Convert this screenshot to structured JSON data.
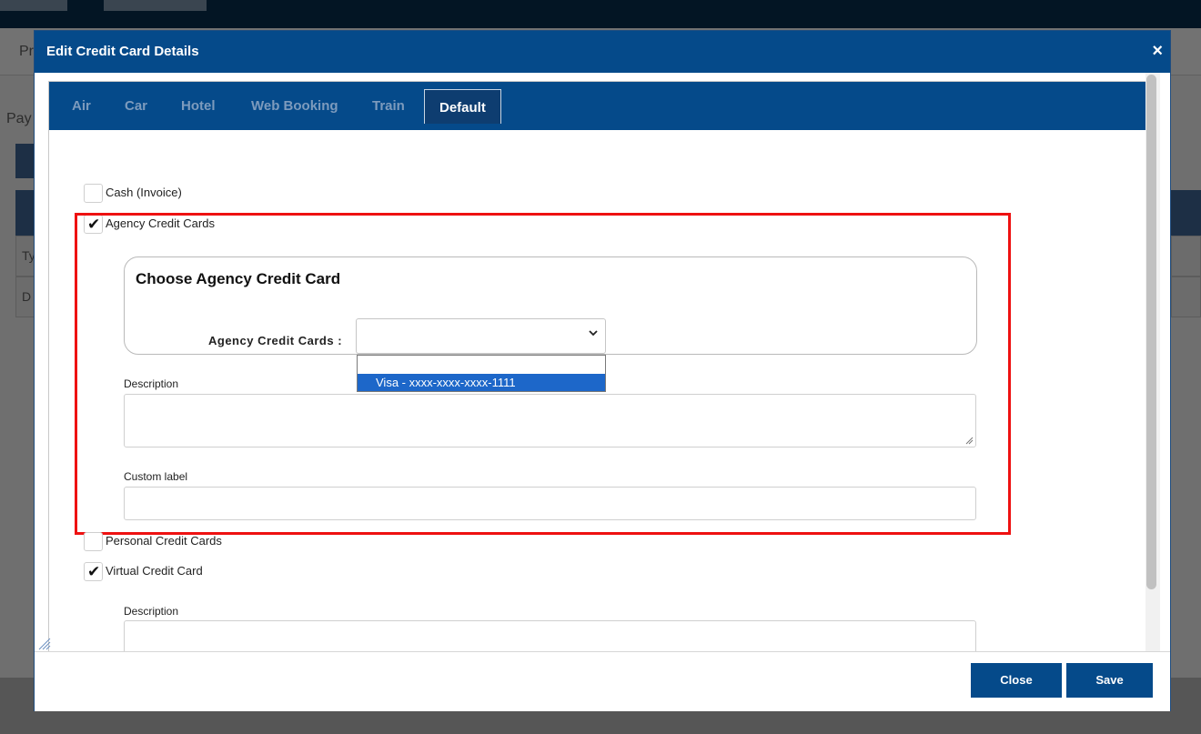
{
  "background": {
    "nav_text": "Pr",
    "section_text": "Pay",
    "row1_text": "Ty",
    "row2_text": "D"
  },
  "modal": {
    "title": "Edit Credit Card Details",
    "close_icon": "×"
  },
  "tabs": [
    {
      "label": "Air",
      "active": false
    },
    {
      "label": "Car",
      "active": false
    },
    {
      "label": "Hotel",
      "active": false
    },
    {
      "label": "Web Booking",
      "active": false
    },
    {
      "label": "Train",
      "active": false
    },
    {
      "label": "Default",
      "active": true
    }
  ],
  "options": {
    "cash": {
      "label": "Cash (Invoice)",
      "checked": false
    },
    "agency": {
      "label": "Agency Credit Cards",
      "checked": true
    },
    "personal": {
      "label": "Personal Credit Cards",
      "checked": false
    },
    "virtual": {
      "label": "Virtual Credit Card",
      "checked": true
    }
  },
  "agency_panel": {
    "title": "Choose Agency Credit Card",
    "select_label": "Agency Credit Cards :",
    "selected_value": "",
    "dropdown_options": [
      "",
      "Visa - xxxx-xxxx-xxxx-1111"
    ]
  },
  "agency_fields": {
    "description_label": "Description",
    "description_value": "",
    "custom_label_label": "Custom label",
    "custom_label_value": ""
  },
  "virtual_fields": {
    "description_label": "Description",
    "description_value": ""
  },
  "footer": {
    "close_label": "Close",
    "save_label": "Save"
  },
  "colors": {
    "header": "#054a8a",
    "highlight": "#ee1111",
    "selected_option": "#1d67c9"
  }
}
